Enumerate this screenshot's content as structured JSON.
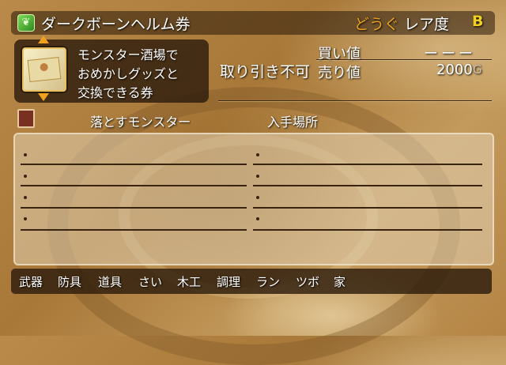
{
  "item": {
    "name": "ダークボーンヘルム券",
    "category": "どうぐ",
    "rarity_label": "レア度",
    "rarity": "B",
    "description": [
      "モンスター酒場で",
      "おめかしグッズと",
      "交換できる券"
    ],
    "trade_status": "取り引き不可",
    "buy_label": "買い値",
    "buy_value": "ーーー",
    "sell_label": "売り値",
    "sell_value": "2000",
    "currency": "G"
  },
  "acquisition": {
    "drops_header": "落とすモンスター",
    "locations_header": "入手場所",
    "drops": [
      "",
      "",
      "",
      ""
    ],
    "locations": [
      "",
      "",
      "",
      ""
    ]
  },
  "category_tabs": [
    "武器",
    "防具",
    "道具",
    "さい",
    "木工",
    "調理",
    "ラン",
    "ツボ",
    "家"
  ],
  "colors": {
    "category": "#e8a020",
    "rarity": "#f2d020",
    "panel": "#2d1c0c"
  },
  "icons": {
    "title_icon": "leaf-icon",
    "list_icon": "book-icon"
  }
}
